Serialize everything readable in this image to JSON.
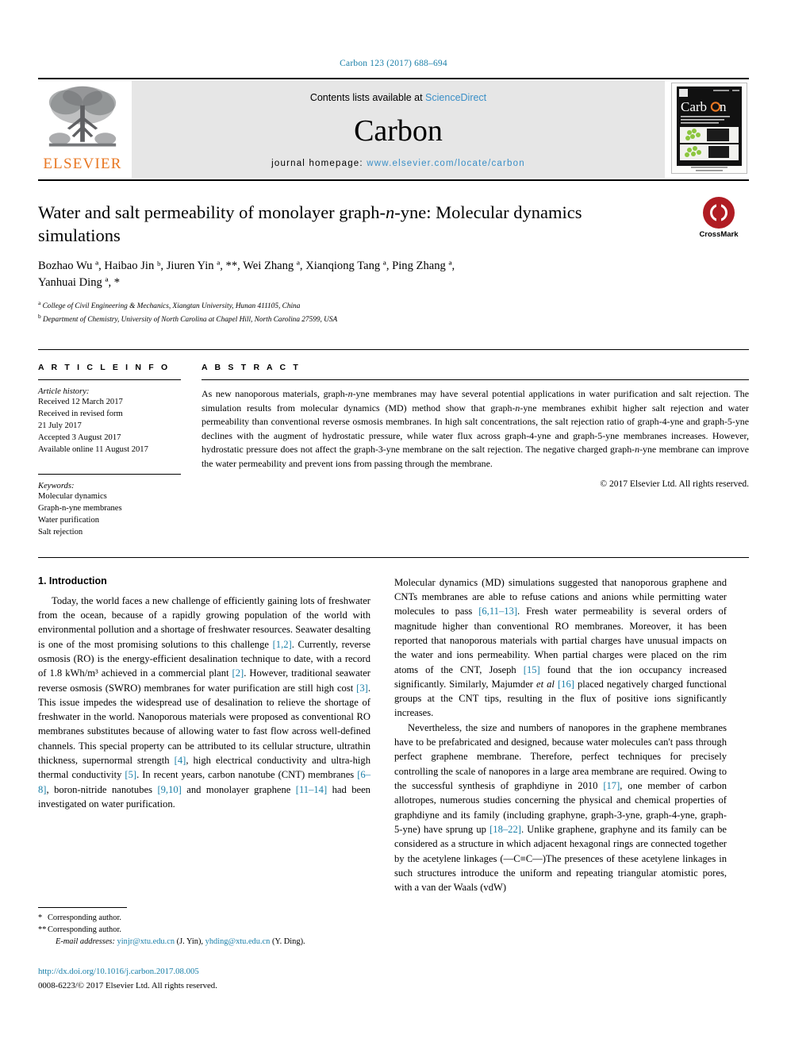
{
  "header": {
    "citation": "Carbon 123 (2017) 688–694"
  },
  "masthead": {
    "publisher": "ELSEVIER",
    "contents_prefix": "Contents lists available at ",
    "contents_link": "ScienceDirect",
    "journal_title": "Carbon",
    "homepage_label": "journal homepage: ",
    "homepage_url": "www.elsevier.com/locate/carbon",
    "cover_title": "Carbon"
  },
  "article": {
    "title_part1": "Water and salt permeability of monolayer graph-",
    "title_italic": "n",
    "title_part2": "-yne: Molecular dynamics simulations",
    "crossmark_label": "CrossMark",
    "authors_line1": "Bozhao Wu ª, Haibao Jin ᵇ, Jiuren Yin ª, **, Wei Zhang ª, Xianqiong Tang ª, Ping Zhang ª,",
    "authors_line2": "Yanhuai Ding ª, *",
    "affiliation_a": "College of Civil Engineering & Mechanics, Xiangtan University, Hunan 411105, China",
    "affiliation_b": "Department of Chemistry, University of North Carolina at Chapel Hill, North Carolina 27599, USA"
  },
  "info": {
    "heading": "A R T I C L E   I N F O",
    "history_label": "Article history:",
    "history": [
      "Received 12 March 2017",
      "Received in revised form",
      "21 July 2017",
      "Accepted 3 August 2017",
      "Available online 11 August 2017"
    ],
    "keywords_label": "Keywords:",
    "keywords": [
      "Molecular dynamics",
      "Graph-n-yne membranes",
      "Water purification",
      "Salt rejection"
    ]
  },
  "abstract": {
    "heading": "A B S T R A C T",
    "text": "As new nanoporous materials, graph-n-yne membranes may have several potential applications in water purification and salt rejection. The simulation results from molecular dynamics (MD) method show that graph-n-yne membranes exhibit higher salt rejection and water permeability than conventional reverse osmosis membranes. In high salt concentrations, the salt rejection ratio of graph-4-yne and graph-5-yne declines with the augment of hydrostatic pressure, while water flux across graph-4-yne and graph-5-yne membranes increases. However, hydrostatic pressure does not affect the graph-3-yne membrane on the salt rejection. The negative charged graph-n-yne membrane can improve the water permeability and prevent ions from passing through the membrane.",
    "copyright": "© 2017 Elsevier Ltd. All rights reserved."
  },
  "body": {
    "section_heading": "1.  Introduction",
    "left_paragraph": "Today, the world faces a new challenge of efficiently gaining lots of freshwater from the ocean, because of a rapidly growing population of the world with environmental pollution and a shortage of freshwater resources. Seawater desalting is one of the most promising solutions to this challenge [1,2]. Currently, reverse osmosis (RO) is the energy-efficient desalination technique to date, with a record of 1.8 kWh/m³ achieved in a commercial plant [2]. However, traditional seawater reverse osmosis (SWRO) membranes for water purification are still high cost [3]. This issue impedes the widespread use of desalination to relieve the shortage of freshwater in the world. Nanoporous materials were proposed as conventional RO membranes substitutes because of allowing water to fast flow across well-defined channels. This special property can be attributed to its cellular structure, ultrathin thickness, supernormal strength [4], high electrical conductivity and ultra-high thermal conductivity [5]. In recent years, carbon nanotube (CNT) membranes [6–8], boron-nitride nanotubes [9,10] and monolayer graphene [11–14] had been investigated on water purification.",
    "right_paragraph_1": "Molecular dynamics (MD) simulations suggested that nanoporous graphene and CNTs membranes are able to refuse cations and anions while permitting water molecules to pass [6,11–13]. Fresh water permeability is several orders of magnitude higher than conventional RO membranes. Moreover, it has been reported that nanoporous materials with partial charges have unusual impacts on the water and ions permeability. When partial charges were placed on the rim atoms of the CNT, Joseph [15] found that the ion occupancy increased significantly. Similarly, Majumder et al [16] placed negatively charged functional groups at the CNT tips, resulting in the flux of positive ions significantly increases.",
    "right_paragraph_2": "Nevertheless, the size and numbers of nanopores in the graphene membranes have to be prefabricated and designed, because water molecules can't pass through perfect graphene membrane. Therefore, perfect techniques for precisely controlling the scale of nanopores in a large area membrane are required. Owing to the successful synthesis of graphdiyne in 2010 [17], one member of carbon allotropes, numerous studies concerning the physical and chemical properties of graphdiyne and its family (including graphyne, graph-3-yne, graph-4-yne, graph-5-yne) have sprung up [18–22]. Unlike graphene, graphyne and its family can be considered as a structure in which adjacent hexagonal rings are connected together by the acetylene linkages (—C≡C—)The presences of these acetylene linkages in such structures introduce the uniform and repeating triangular atomistic pores, with a van der Waals (vdW)"
  },
  "footnotes": {
    "corresponding_1": "Corresponding author.",
    "corresponding_2": "Corresponding author.",
    "email_label": "E-mail addresses:",
    "email_1": "yinjr@xtu.edu.cn",
    "email_1_name": "(J. Yin),",
    "email_2": "yhding@xtu.edu.cn",
    "email_2_name": "(Y. Ding).",
    "doi": "http://dx.doi.org/10.1016/j.carbon.2017.08.005",
    "issn": "0008-6223/© 2017 Elsevier Ltd. All rights reserved."
  },
  "colors": {
    "link": "#1a7fa8",
    "elsevier_orange": "#e87722",
    "crossmark_red": "#b01c23"
  }
}
